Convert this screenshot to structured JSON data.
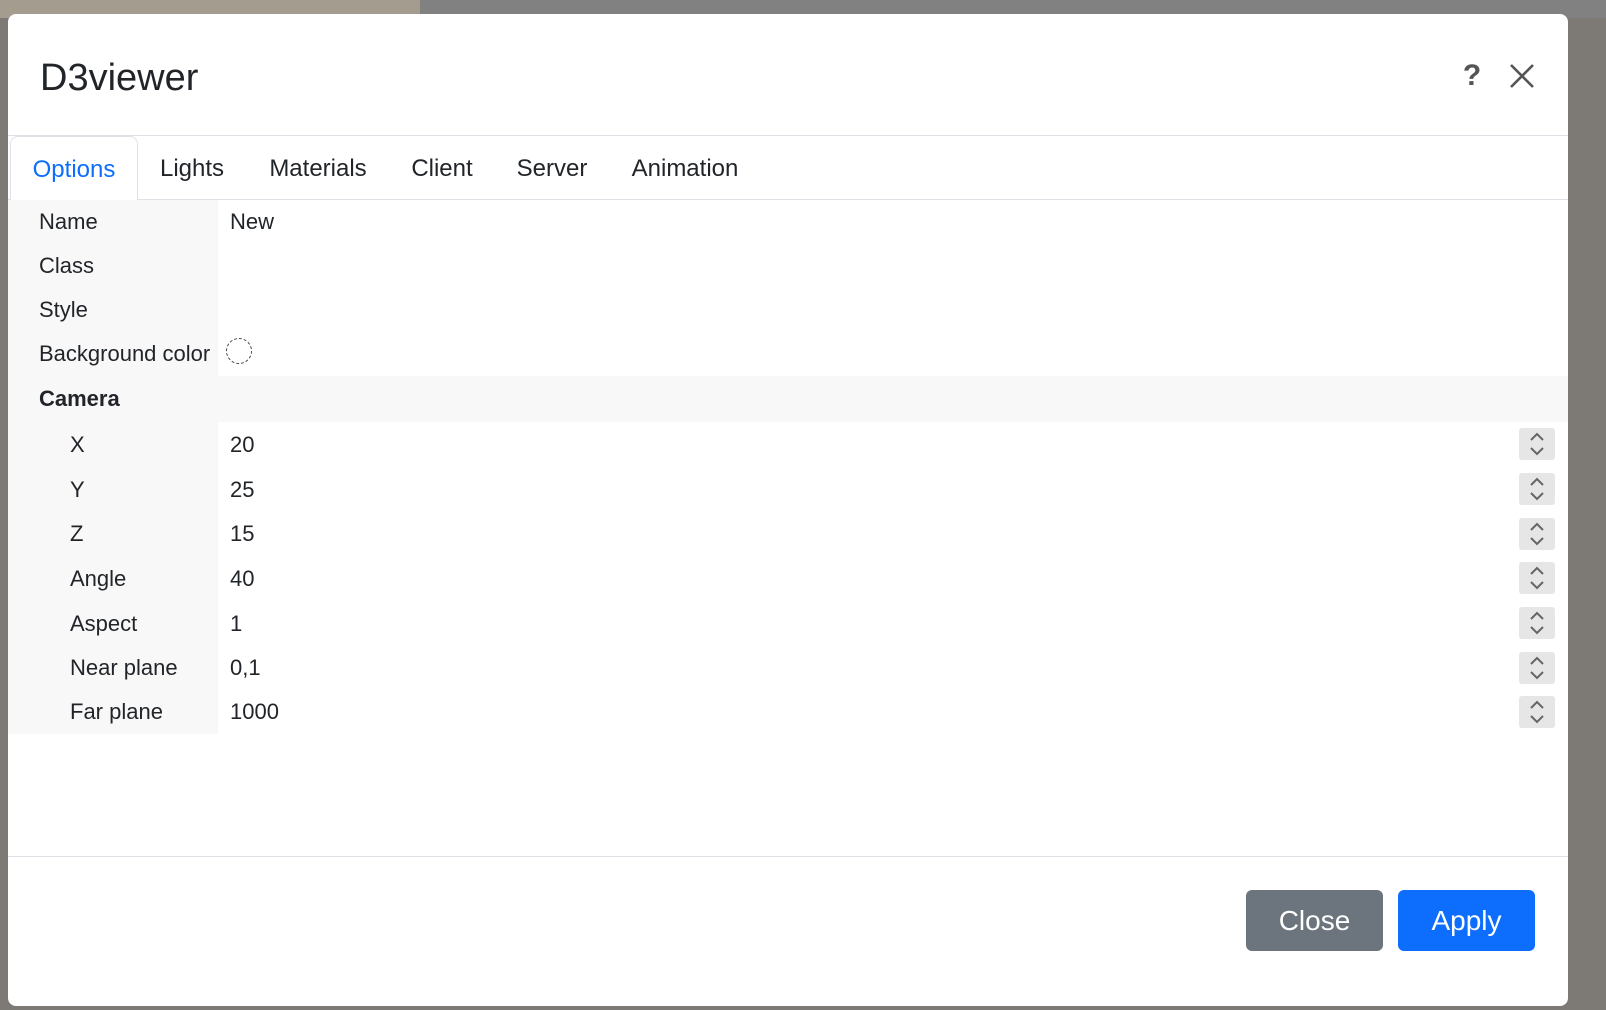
{
  "dialog": {
    "title": "D3viewer",
    "help_symbol": "?"
  },
  "tabs": [
    "Options",
    "Lights",
    "Materials",
    "Client",
    "Server",
    "Animation"
  ],
  "active_tab": "Options",
  "fields": {
    "name": {
      "label": "Name",
      "value": "New"
    },
    "class": {
      "label": "Class",
      "value": ""
    },
    "style": {
      "label": "Style",
      "value": ""
    },
    "background_color": {
      "label": "Background color"
    }
  },
  "camera": {
    "section_label": "Camera",
    "x": {
      "label": "X",
      "value": "20"
    },
    "y": {
      "label": "Y",
      "value": "25"
    },
    "z": {
      "label": "Z",
      "value": "15"
    },
    "angle": {
      "label": "Angle",
      "value": "40"
    },
    "aspect": {
      "label": "Aspect",
      "value": "1"
    },
    "near_plane": {
      "label": "Near plane",
      "value": "0,1"
    },
    "far_plane": {
      "label": "Far plane",
      "value": "1000"
    }
  },
  "footer": {
    "close_label": "Close",
    "apply_label": "Apply"
  },
  "colors": {
    "primary": "#0d6efd",
    "secondary": "#6c757d",
    "label_bg": "#f8f8f8"
  }
}
